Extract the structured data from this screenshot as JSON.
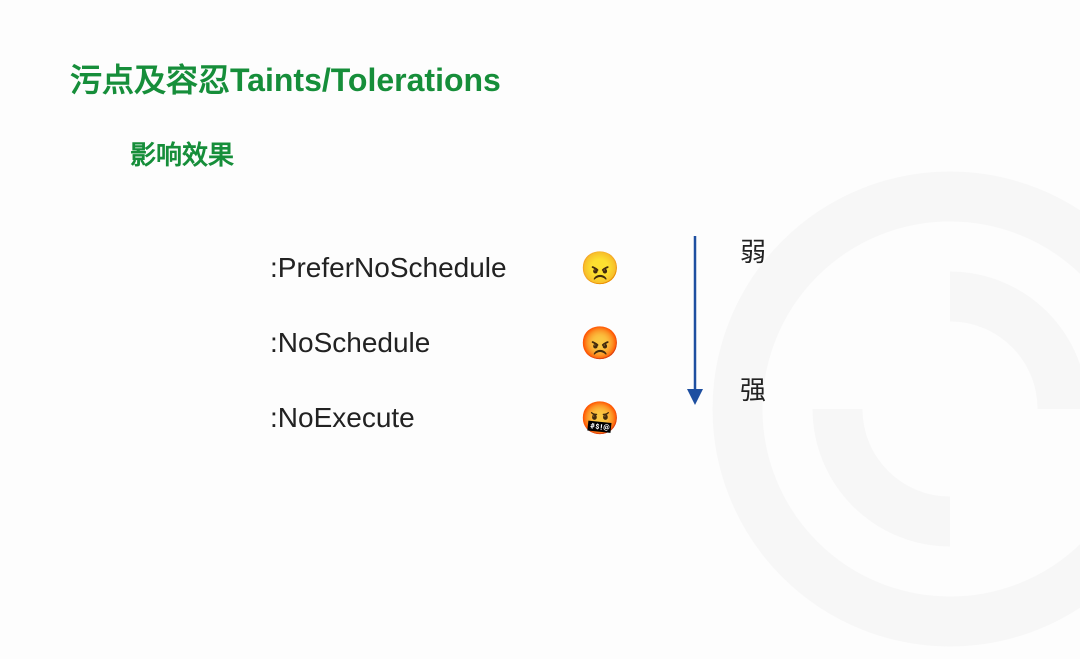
{
  "title": "污点及容忍Taints/Tolerations",
  "subtitle": "影响效果",
  "items": [
    {
      "label": ":PreferNoSchedule",
      "emoji": "😠"
    },
    {
      "label": ":NoSchedule",
      "emoji": "😡"
    },
    {
      "label": ":NoExecute",
      "emoji": "🤬"
    }
  ],
  "scale": {
    "top": "弱",
    "bottom": "强"
  },
  "colors": {
    "accent": "#168e3a",
    "arrow": "#1e4fa0"
  }
}
